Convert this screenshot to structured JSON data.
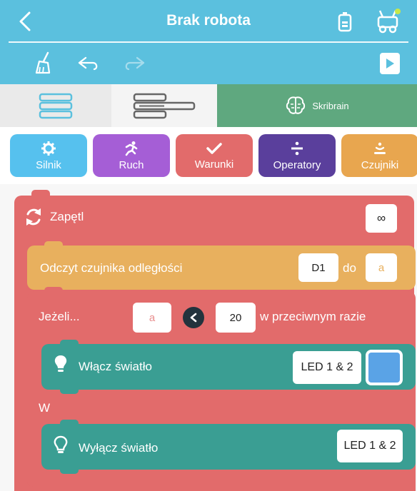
{
  "header": {
    "title": "Brak robota",
    "back_icon": "chevron-left-icon",
    "battery_icon": "battery-icon",
    "robot_icon": "robot-connection-icon"
  },
  "toolbar": {
    "clear_icon": "broom-icon",
    "undo_icon": "undo-icon",
    "redo_icon": "redo-icon",
    "run_icon": "play-icon"
  },
  "category_tabs": {
    "tab1_icon": "blocks-simple-icon",
    "tab2_icon": "blocks-advanced-icon",
    "tab3_label": "Skribrain",
    "tab3_icon": "brain-icon"
  },
  "block_categories": [
    {
      "label": "Silnik",
      "icon": "gear-icon",
      "color": "#56c1ee"
    },
    {
      "label": "Ruch",
      "icon": "running-icon",
      "color": "#a55ed6"
    },
    {
      "label": "Warunki",
      "icon": "check-icon",
      "color": "#e26b6b"
    },
    {
      "label": "Operatory",
      "icon": "divide-icon",
      "color": "#5a3f9c"
    },
    {
      "label": "Czujniki",
      "icon": "sensor-icon",
      "color": "#e8a64f"
    }
  ],
  "program": {
    "loop": {
      "label": "Zapętl",
      "count": "∞",
      "icon": "loop-icon"
    },
    "read_sensor": {
      "label": "Odczyt czujnika odległości",
      "port": "D1",
      "to_label": "do",
      "variable": "a"
    },
    "if_block": {
      "label": "Jeżeli...",
      "variable": "a",
      "comparator_icon": "less-than-icon",
      "value": "20",
      "else_label": "w przeciwnym razie"
    },
    "light_on": {
      "label": "Włącz światło",
      "leds": "LED 1 & 2",
      "color": "#5aa3e6",
      "icon": "bulb-on-icon"
    },
    "else_label": "W",
    "light_off": {
      "label": "Wyłącz światło",
      "leds": "LED 1 & 2",
      "icon": "bulb-off-icon"
    }
  }
}
